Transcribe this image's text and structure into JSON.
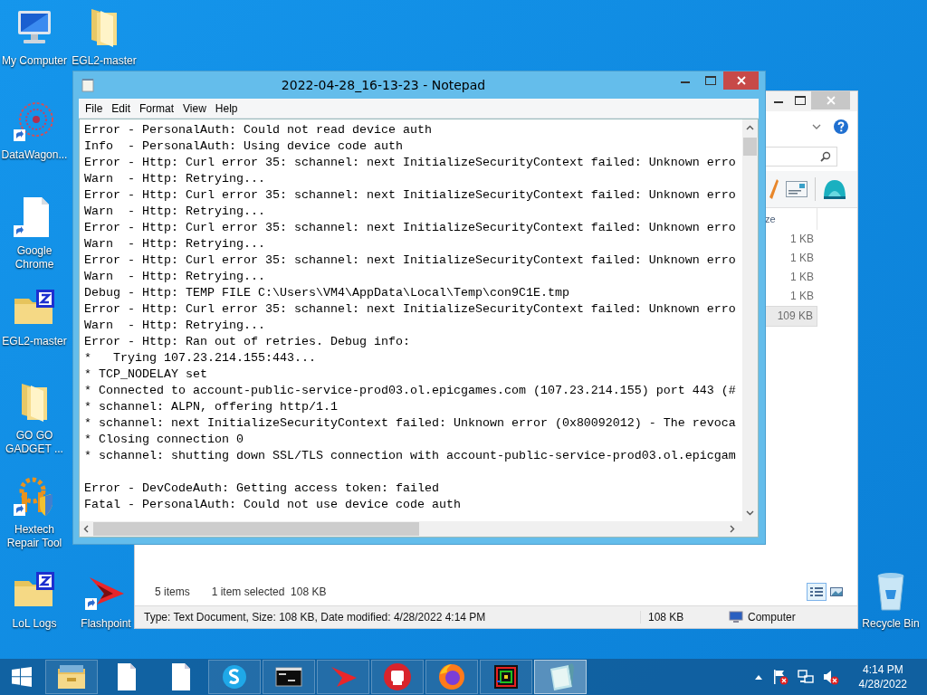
{
  "desktop_icons": [
    {
      "label": "My Computer",
      "kind": "computer",
      "shortcut": false
    },
    {
      "label": "EGL2-master",
      "kind": "folder",
      "shortcut": false
    },
    {
      "label": "DataWagon...",
      "kind": "network-art",
      "shortcut": true
    },
    {
      "label": "Google Chrome",
      "kind": "document",
      "shortcut": true
    },
    {
      "label": "EGL2-master",
      "kind": "zip-folder",
      "shortcut": false
    },
    {
      "label": "GO GO GADGET ...",
      "kind": "folder",
      "shortcut": false
    },
    {
      "label": "Hextech Repair Tool",
      "kind": "tools",
      "shortcut": true
    },
    {
      "label": "LoL Logs",
      "kind": "zip-folder",
      "shortcut": false
    },
    {
      "label": "Flashpoint",
      "kind": "flashpoint",
      "shortcut": true
    },
    {
      "label": "Recycle Bin",
      "kind": "recycle",
      "shortcut": false
    }
  ],
  "explorer": {
    "column_header": "ze",
    "sizes": [
      {
        "text": "1 KB",
        "selected": false
      },
      {
        "text": "1 KB",
        "selected": false
      },
      {
        "text": "1 KB",
        "selected": false
      },
      {
        "text": "1 KB",
        "selected": false
      },
      {
        "text": "109 KB",
        "selected": true
      }
    ],
    "item_count": "5 items",
    "selection": "1 item selected  108 KB",
    "status_bar": {
      "details": "Type: Text Document, Size: 108 KB, Date modified: 4/28/2022 4:14 PM",
      "size": "108 KB",
      "location": "Computer"
    }
  },
  "notepad": {
    "title": "2022-04-28_16-13-23 - Notepad",
    "menu": [
      "File",
      "Edit",
      "Format",
      "View",
      "Help"
    ],
    "blocks": [
      [
        "Error - PersonalAuth: Could not read device auth",
        "Info  - PersonalAuth: Using device code auth",
        "Error - Http: Curl error 35: schannel: next InitializeSecurityContext failed: Unknown erro",
        "Warn  - Http: Retrying...",
        "Error - Http: Curl error 35: schannel: next InitializeSecurityContext failed: Unknown erro",
        "Warn  - Http: Retrying...",
        "Error - Http: Curl error 35: schannel: next InitializeSecurityContext failed: Unknown erro",
        "Warn  - Http: Retrying...",
        "Error - Http: Curl error 35: schannel: next InitializeSecurityContext failed: Unknown erro",
        "Warn  - Http: Retrying...",
        "Debug - Http: TEMP FILE C:\\Users\\VM4\\AppData\\Local\\Temp\\con9C1E.tmp",
        "Error - Http: Curl error 35: schannel: next InitializeSecurityContext failed: Unknown erro",
        "Warn  - Http: Retrying...",
        "Error - Http: Ran out of retries. Debug info:",
        "*   Trying 107.23.214.155:443...",
        "* TCP_NODELAY set",
        "* Connected to account-public-service-prod03.ol.epicgames.com (107.23.214.155) port 443 (#",
        "* schannel: ALPN, offering http/1.1",
        "* schannel: next InitializeSecurityContext failed: Unknown error (0x80092012) - The revoca",
        "* Closing connection 0",
        "* schannel: shutting down SSL/TLS connection with account-public-service-prod03.ol.epicgam"
      ],
      [
        "Error - DevCodeAuth: Getting access token: failed",
        "Fatal - PersonalAuth: Could not use device code auth"
      ]
    ]
  },
  "taskbar": {
    "apps": [
      {
        "kind": "explorer",
        "running": true,
        "active": false
      },
      {
        "kind": "document",
        "running": false,
        "active": false
      },
      {
        "kind": "document",
        "running": false,
        "active": false
      },
      {
        "kind": "skype",
        "running": true,
        "active": false
      },
      {
        "kind": "console",
        "running": true,
        "active": false
      },
      {
        "kind": "flashpoint",
        "running": true,
        "active": false
      },
      {
        "kind": "riot",
        "running": true,
        "active": false
      },
      {
        "kind": "firefox",
        "running": true,
        "active": false
      },
      {
        "kind": "colorful",
        "running": true,
        "active": false
      },
      {
        "kind": "notepad",
        "running": true,
        "active": true
      }
    ],
    "clock": {
      "time": "4:14 PM",
      "date": "4/28/2022"
    }
  }
}
